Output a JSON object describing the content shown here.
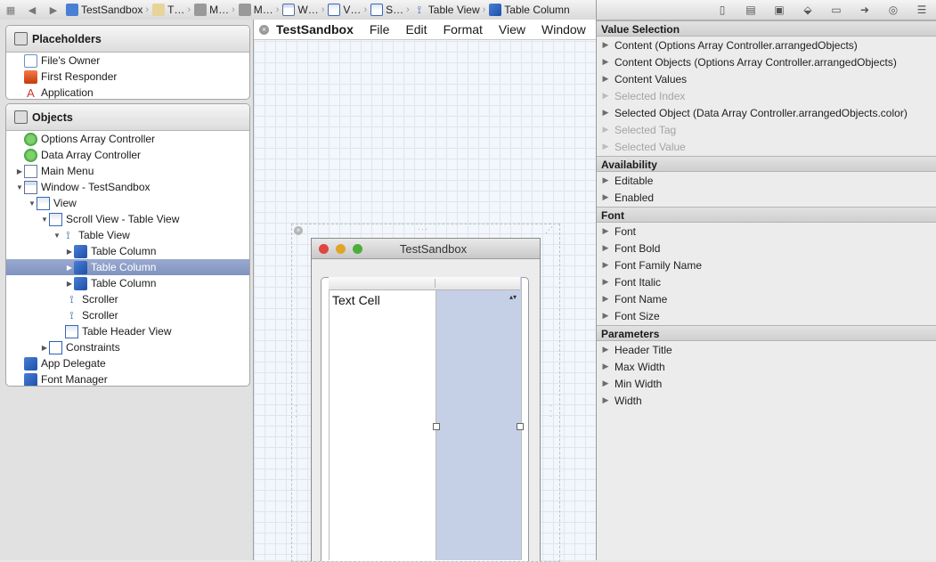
{
  "jumpbar": {
    "crumbs": [
      {
        "label": "TestSandbox",
        "icon": "project-icon"
      },
      {
        "label": "T…",
        "icon": "folder-icon"
      },
      {
        "label": "M…",
        "icon": "xib-icon"
      },
      {
        "label": "M…",
        "icon": "xib-icon"
      },
      {
        "label": "W…",
        "icon": "window-icon"
      },
      {
        "label": "V…",
        "icon": "view-icon"
      },
      {
        "label": "S…",
        "icon": "scroll-view-icon"
      },
      {
        "label": "Table View",
        "icon": "table-view-icon"
      },
      {
        "label": "Table Column",
        "icon": "table-column-icon"
      }
    ]
  },
  "outline": {
    "placeholders": {
      "title": "Placeholders",
      "items": [
        "File's Owner",
        "First Responder",
        "Application"
      ]
    },
    "objects": {
      "title": "Objects",
      "items": [
        "Options Array Controller",
        "Data Array Controller",
        "Main Menu",
        "Window - TestSandbox",
        "View",
        "Scroll View - Table View",
        "Table View",
        "Table Column",
        "Table Column",
        "Table Column",
        "Scroller",
        "Scroller",
        "Table Header View",
        "Constraints",
        "App Delegate",
        "Font Manager"
      ]
    }
  },
  "menubar": {
    "items": [
      "TestSandbox",
      "File",
      "Edit",
      "Format",
      "View",
      "Window"
    ]
  },
  "window": {
    "title": "TestSandbox",
    "cell_text": "Text Cell",
    "stepper_glyph": "▴▾"
  },
  "inspector": {
    "sections": [
      {
        "title": "Value Selection",
        "rows": [
          {
            "label": "Content (Options Array Controller.arrangedObjects)",
            "disabled": false
          },
          {
            "label": "Content Objects (Options Array Controller.arrangedObjects)",
            "disabled": false
          },
          {
            "label": "Content Values",
            "disabled": false
          },
          {
            "label": "Selected Index",
            "disabled": true
          },
          {
            "label": "Selected Object (Data Array Controller.arrangedObjects.color)",
            "disabled": false
          },
          {
            "label": "Selected Tag",
            "disabled": true
          },
          {
            "label": "Selected Value",
            "disabled": true
          }
        ]
      },
      {
        "title": "Availability",
        "rows": [
          {
            "label": "Editable",
            "disabled": false
          },
          {
            "label": "Enabled",
            "disabled": false
          }
        ]
      },
      {
        "title": "Font",
        "rows": [
          {
            "label": "Font",
            "disabled": false
          },
          {
            "label": "Font Bold",
            "disabled": false
          },
          {
            "label": "Font Family Name",
            "disabled": false
          },
          {
            "label": "Font Italic",
            "disabled": false
          },
          {
            "label": "Font Name",
            "disabled": false
          },
          {
            "label": "Font Size",
            "disabled": false
          }
        ]
      },
      {
        "title": "Parameters",
        "rows": [
          {
            "label": "Header Title",
            "disabled": false
          },
          {
            "label": "Max Width",
            "disabled": false
          },
          {
            "label": "Min Width",
            "disabled": false
          },
          {
            "label": "Width",
            "disabled": false
          }
        ]
      }
    ]
  },
  "colors": {
    "selection": "#8a9cc8",
    "column_highlight": "#c5cfe6",
    "close_light": "#e0443e",
    "minimize_light": "#e0a526",
    "zoom_light": "#4cae3a"
  }
}
